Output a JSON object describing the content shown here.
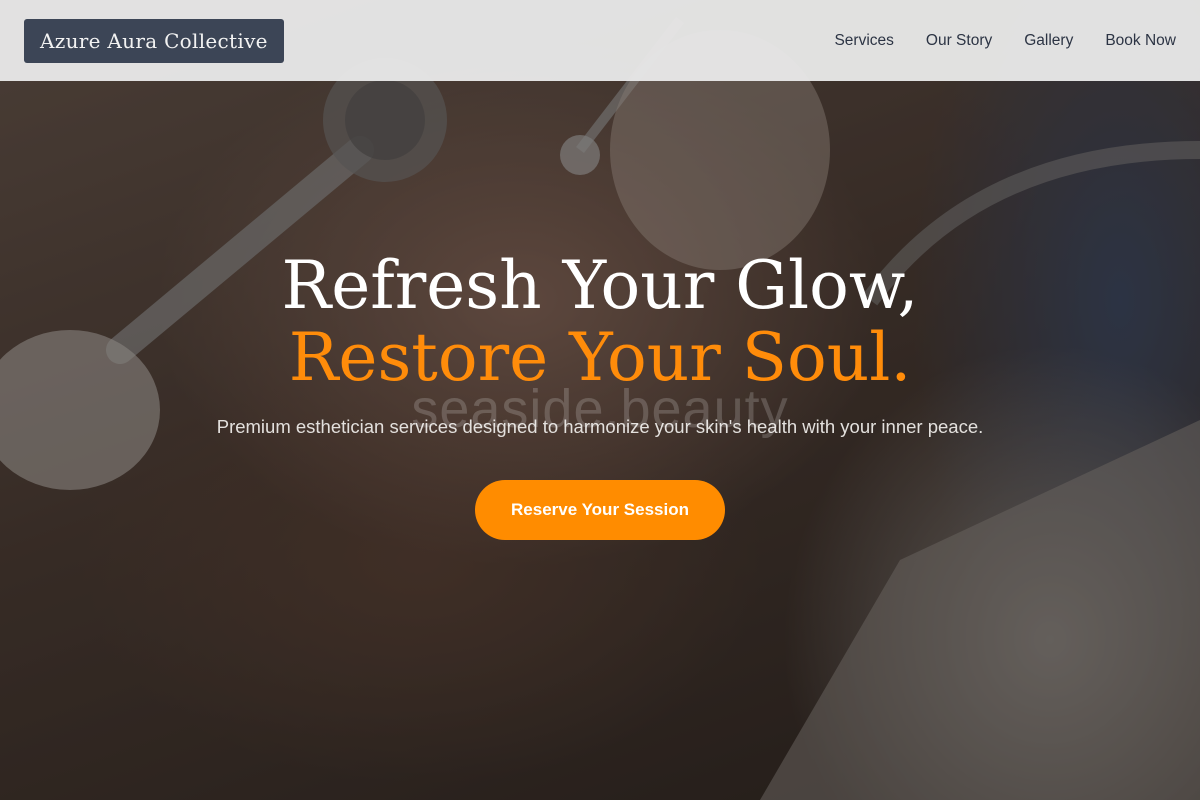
{
  "header": {
    "brand": "Azure Aura Collective",
    "nav": [
      "Services",
      "Our Story",
      "Gallery",
      "Book Now"
    ]
  },
  "hero": {
    "headline_line1": "Refresh Your Glow,",
    "headline_line2": "Restore Your Soul.",
    "watermark": "seaside.beauty",
    "subtitle": "Premium esthetician services designed to harmonize your skin's health with your inner peace.",
    "cta_label": "Reserve Your Session"
  },
  "colors": {
    "accent": "#ff8c00",
    "brand_bg": "#3c4556",
    "header_bg": "#e8e8e8"
  }
}
